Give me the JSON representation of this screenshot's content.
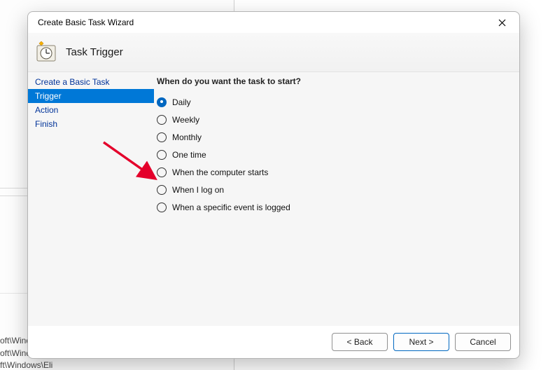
{
  "bg": {
    "line1": "oft\\Windo",
    "line2": "oft\\Windows\\U...",
    "line3": "ft\\Windows\\Eli"
  },
  "dialog": {
    "title": "Create Basic Task Wizard",
    "header": "Task Trigger"
  },
  "sidebar": {
    "items": [
      {
        "label": "Create a Basic Task",
        "active": false
      },
      {
        "label": "Trigger",
        "active": true
      },
      {
        "label": "Action",
        "active": false
      },
      {
        "label": "Finish",
        "active": false
      }
    ]
  },
  "content": {
    "question": "When do you want the task to start?",
    "options": [
      {
        "label": "Daily",
        "selected": true
      },
      {
        "label": "Weekly",
        "selected": false
      },
      {
        "label": "Monthly",
        "selected": false
      },
      {
        "label": "One time",
        "selected": false
      },
      {
        "label": "When the computer starts",
        "selected": false
      },
      {
        "label": "When I log on",
        "selected": false
      },
      {
        "label": "When a specific event is logged",
        "selected": false
      }
    ]
  },
  "footer": {
    "back": "< Back",
    "next": "Next >",
    "cancel": "Cancel"
  },
  "annotation": {
    "arrow_color": "#e4002b"
  }
}
